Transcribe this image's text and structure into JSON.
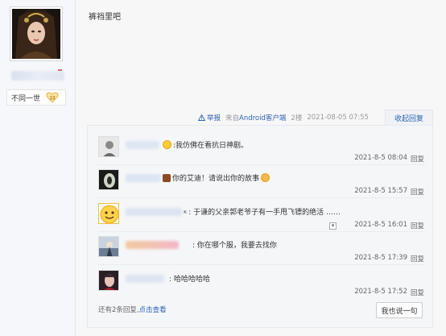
{
  "author": {
    "level_title": "不同一世",
    "level_number": "13"
  },
  "post": {
    "content": "裤裆里吧",
    "report_label": "举报",
    "client_prefix": "来自",
    "client_name": "Android客户端",
    "floor": "2楼",
    "datetime": "2021-08-05 07:55",
    "collapse_label": "收起回复"
  },
  "replies": [
    {
      "text": ":我仿佛在看抗日神剧。",
      "time": "2021-8-5 08:04",
      "reply_label": "回复"
    },
    {
      "text": "你的艾迪！请说出你的故事",
      "time": "2021-8-5 15:57",
      "reply_label": "回复"
    },
    {
      "text": ": 于谦的父亲郭老爷子有一手甩飞镖的绝活 ……",
      "time": "2021-8-5 16:01",
      "reply_label": "回复"
    },
    {
      "text": ": 你在哪个服，我要去找你",
      "time": "2021-8-5 17:39",
      "reply_label": "回复"
    },
    {
      "text": ": 哈哈哈哈哈",
      "time": "2021-8-5 17:52",
      "reply_label": "回复"
    }
  ],
  "footer": {
    "more_text": "还有2条回复,",
    "view_link": "点击查看",
    "me_too_button": "我也说一句"
  },
  "colors": {
    "link": "#2d64b3",
    "panel_bg": "#f5f6f8",
    "sidebar_bg": "#f5f7fa"
  }
}
